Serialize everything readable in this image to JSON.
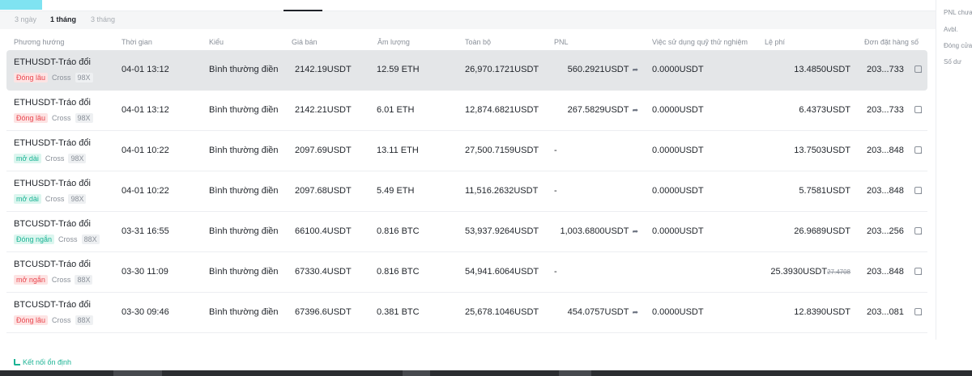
{
  "periods": [
    "3 ngày",
    "1 tháng",
    "3 tháng"
  ],
  "active_period": "1 tháng",
  "columns": {
    "direction": "Phương hướng",
    "time": "Thời gian",
    "type": "Kiểu",
    "price": "Giá bán",
    "volume": "Âm lượng",
    "total": "Toàn bộ",
    "pnl": "PNL",
    "trial_fund": "Việc sử dụng quỹ thử nghiệm",
    "fee": "Lệ phí",
    "order_no": "Đơn đặt hàng số"
  },
  "rows": [
    {
      "symbol": "ETHUSDT-Tráo đổi",
      "side": "Đóng lâu",
      "side_kind": "short",
      "margin": "Cross",
      "leverage": "98X",
      "time": "04-01 13:12",
      "type": "Bình thường điền",
      "price": "2142.19USDT",
      "volume": "12.59 ETH",
      "total": "26,970.1721USDT",
      "pnl": "560.2921USDT",
      "trial": "0.0000USDT",
      "fee": "13.4850USDT",
      "fee_old": "",
      "order": "203...733",
      "selected": true
    },
    {
      "symbol": "ETHUSDT-Tráo đổi",
      "side": "Đóng lâu",
      "side_kind": "short",
      "margin": "Cross",
      "leverage": "98X",
      "time": "04-01 13:12",
      "type": "Bình thường điền",
      "price": "2142.21USDT",
      "volume": "6.01 ETH",
      "total": "12,874.6821USDT",
      "pnl": "267.5829USDT",
      "trial": "0.0000USDT",
      "fee": "6.4373USDT",
      "fee_old": "",
      "order": "203...733",
      "selected": false
    },
    {
      "symbol": "ETHUSDT-Tráo đổi",
      "side": "mở dài",
      "side_kind": "long",
      "margin": "Cross",
      "leverage": "98X",
      "time": "04-01 10:22",
      "type": "Bình thường điền",
      "price": "2097.69USDT",
      "volume": "13.11 ETH",
      "total": "27,500.7159USDT",
      "pnl": "-",
      "trial": "0.0000USDT",
      "fee": "13.7503USDT",
      "fee_old": "",
      "order": "203...848",
      "selected": false
    },
    {
      "symbol": "ETHUSDT-Tráo đổi",
      "side": "mở dài",
      "side_kind": "long",
      "margin": "Cross",
      "leverage": "98X",
      "time": "04-01 10:22",
      "type": "Bình thường điền",
      "price": "2097.68USDT",
      "volume": "5.49 ETH",
      "total": "11,516.2632USDT",
      "pnl": "-",
      "trial": "0.0000USDT",
      "fee": "5.7581USDT",
      "fee_old": "",
      "order": "203...848",
      "selected": false
    },
    {
      "symbol": "BTCUSDT-Tráo đổi",
      "side": "Đóng ngắn",
      "side_kind": "long",
      "margin": "Cross",
      "leverage": "88X",
      "time": "03-31 16:55",
      "type": "Bình thường điền",
      "price": "66100.4USDT",
      "volume": "0.816 BTC",
      "total": "53,937.9264USDT",
      "pnl": "1,003.6800USDT",
      "trial": "0.0000USDT",
      "fee": "26.9689USDT",
      "fee_old": "",
      "order": "203...256",
      "selected": false
    },
    {
      "symbol": "BTCUSDT-Tráo đổi",
      "side": "mở ngắn",
      "side_kind": "short",
      "margin": "Cross",
      "leverage": "88X",
      "time": "03-30 11:09",
      "type": "Bình thường điền",
      "price": "67330.4USDT",
      "volume": "0.816 BTC",
      "total": "54,941.6064USDT",
      "pnl": "-",
      "trial": "",
      "fee": "25.3930USDT",
      "fee_old": "27.4708",
      "order": "203...848",
      "selected": false
    },
    {
      "symbol": "BTCUSDT-Tráo đổi",
      "side": "Đóng lâu",
      "side_kind": "short",
      "margin": "Cross",
      "leverage": "88X",
      "time": "03-30 09:46",
      "type": "Bình thường điền",
      "price": "67396.6USDT",
      "volume": "0.381 BTC",
      "total": "25,678.1046USDT",
      "pnl": "454.0757USDT",
      "trial": "0.0000USDT",
      "fee": "12.8390USDT",
      "fee_old": "",
      "order": "203...081",
      "selected": false
    }
  ],
  "side_panel": [
    "PNL chưa",
    "Avbl.",
    "Đóng cửa",
    "Số dư"
  ],
  "status": "Kết nối ổn định",
  "icons": {
    "share": "share-icon",
    "copy": "copy-icon",
    "connection": "signal-icon"
  },
  "colors": {
    "short": "#e9474f",
    "long": "#1ab394",
    "accent": "#7fe3f1"
  }
}
